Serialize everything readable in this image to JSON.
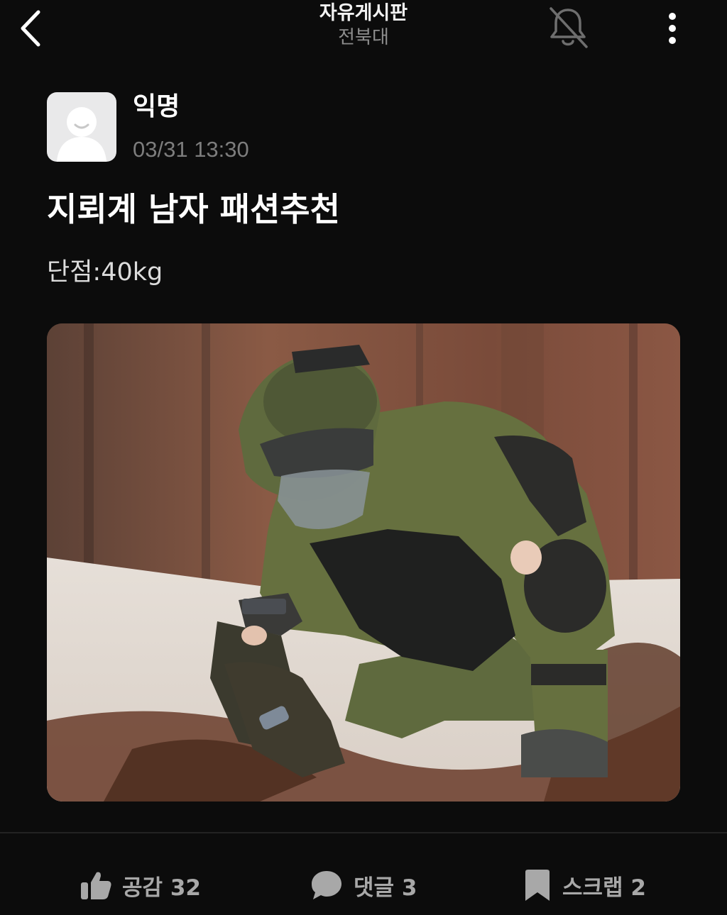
{
  "header": {
    "board_title": "자유게시판",
    "school_name": "전북대",
    "back_icon": "chevron-left-icon",
    "bell_icon": "bell-off-icon",
    "more_icon": "more-vertical-icon"
  },
  "post": {
    "author": "익명",
    "time": "03/31 13:30",
    "title": "지뢰계 남자 패션추천",
    "body": "단점:40kg",
    "avatar_icon": "anonymous-avatar-icon"
  },
  "actions": {
    "like_label": "공감 32",
    "comment_label": "댓글 3",
    "scrap_label": "스크랩 2"
  },
  "colors": {
    "background": "#0c0c0c",
    "text_primary": "#ffffff",
    "text_secondary": "#7d7d7d",
    "action_gray": "#a8a8a8",
    "avatar_bg": "#e9e9ea"
  }
}
